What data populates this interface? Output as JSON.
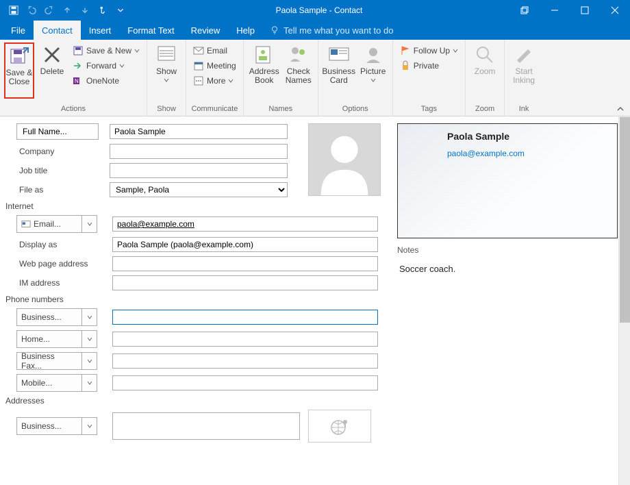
{
  "window": {
    "title": "Paola Sample  -  Contact"
  },
  "tabs": {
    "file": "File",
    "contact": "Contact",
    "insert": "Insert",
    "format": "Format Text",
    "review": "Review",
    "help": "Help",
    "tellme": "Tell me what you want to do"
  },
  "ribbon": {
    "actions": {
      "group": "Actions",
      "save_close": "Save & Close",
      "delete": "Delete",
      "save_new": "Save & New",
      "forward": "Forward",
      "onenote": "OneNote"
    },
    "show": {
      "group": "Show",
      "show": "Show"
    },
    "communicate": {
      "group": "Communicate",
      "email": "Email",
      "meeting": "Meeting",
      "more": "More"
    },
    "names": {
      "group": "Names",
      "addr": "Address Book",
      "check": "Check Names"
    },
    "options": {
      "group": "Options",
      "biz": "Business Card",
      "pic": "Picture"
    },
    "tags": {
      "group": "Tags",
      "followup": "Follow Up",
      "private": "Private"
    },
    "zoom": {
      "group": "Zoom",
      "zoom": "Zoom"
    },
    "ink": {
      "group": "Ink",
      "start": "Start Inking"
    }
  },
  "form": {
    "full_name_btn": "Full Name...",
    "full_name_val": "Paola Sample",
    "company_lbl": "Company",
    "company_val": "",
    "job_lbl": "Job title",
    "job_val": "",
    "fileas_lbl": "File as",
    "fileas_val": "Sample, Paola",
    "internet_lbl": "Internet",
    "email_btn": "Email...",
    "email_val": "paola@example.com",
    "display_lbl": "Display as",
    "display_val": "Paola Sample (paola@example.com)",
    "web_lbl": "Web page address",
    "web_val": "",
    "im_lbl": "IM address",
    "im_val": "",
    "phones_lbl": "Phone numbers",
    "phone_biz": "Business...",
    "phone_home": "Home...",
    "phone_fax": "Business Fax...",
    "phone_mobile": "Mobile...",
    "addr_lbl": "Addresses",
    "addr_biz": "Business..."
  },
  "card": {
    "name": "Paola Sample",
    "mail": "paola@example.com"
  },
  "notes": {
    "label": "Notes",
    "text": "Soccer coach."
  }
}
